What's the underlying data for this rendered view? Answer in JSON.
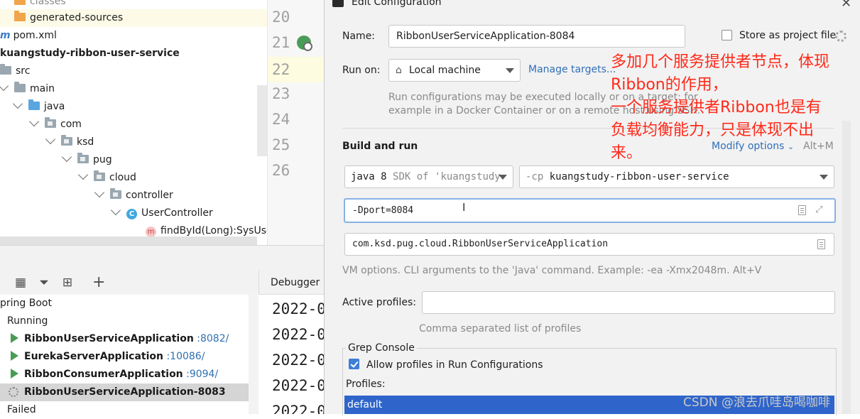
{
  "tree": {
    "items": [
      {
        "label": "classes",
        "icon": "folder-icon",
        "color": "#f0a54b"
      },
      {
        "label": "generated-sources",
        "icon": "folder-icon",
        "color": "#f0a54b"
      },
      {
        "label": "pom.xml",
        "icon": "maven-icon"
      },
      {
        "label": "kuangstudy-ribbon-user-service",
        "icon": "module-icon"
      },
      {
        "label": "src",
        "icon": "folder-icon"
      },
      {
        "label": "main",
        "icon": "folder-icon"
      },
      {
        "label": "java",
        "icon": "source-folder-icon"
      },
      {
        "label": "com",
        "icon": "package-icon"
      },
      {
        "label": "ksd",
        "icon": "package-icon"
      },
      {
        "label": "pug",
        "icon": "package-icon"
      },
      {
        "label": "cloud",
        "icon": "package-icon"
      },
      {
        "label": "controller",
        "icon": "package-icon"
      },
      {
        "label": "UserController",
        "icon": "class-icon"
      },
      {
        "label": "findById(Long):SysUse",
        "icon": "method-icon"
      }
    ],
    "maven_glyph": "m",
    "class_glyph": "C",
    "method_glyph": "m"
  },
  "editor": {
    "line_numbers": [
      "20",
      "21",
      "22",
      "23",
      "24",
      "25",
      "26"
    ]
  },
  "services": {
    "debugger_tab": "Debugger",
    "group": "pring Boot",
    "running_label": "Running",
    "apps": [
      {
        "name": "RibbonUserServiceApplication",
        "port": ":8082/"
      },
      {
        "name": "EurekaServerApplication",
        "port": ":10086/"
      },
      {
        "name": "RibbonConsumerApplication",
        "port": ":9094/"
      }
    ],
    "starting_app": "RibbonUserServiceApplication-8083",
    "failed_label": "Failed",
    "console_lines": [
      "2022-0",
      "2022-0",
      "2022-0",
      "2022-0",
      "2022-0"
    ]
  },
  "dialog": {
    "title": "Edit Configuration",
    "name_label": "Name:",
    "name_value": "RibbonUserServiceApplication-8084",
    "store_label": "Store as project file",
    "run_on_label": "Run on:",
    "run_on_value": "Local machine",
    "manage_targets": "Manage targets...",
    "run_on_help_1": "Run configurations may be executed locally or on a target: for",
    "run_on_help_2": "example in a Docker Container or on a remote host using SSH.",
    "build_and_run": "Build and run",
    "modify_options": "Modify options",
    "modify_shortcut": "Alt+M",
    "jdk_bold": "java 8",
    "jdk_hint": "SDK of 'kuangstudy",
    "cp_prefix": "-cp",
    "cp_value": "kuangstudy-ribbon-user-service",
    "vm_options": "-Dport=8084",
    "main_class": "com.ksd.pug.cloud.RibbonUserServiceApplication",
    "vm_help": "VM options. CLI arguments to the 'Java' command. Example: -ea -Xmx2048m. Alt+V",
    "active_profiles_label": "Active profiles:",
    "active_profiles_value": "",
    "profiles_help": "Comma separated list of profiles",
    "grep_console": "Grep Console",
    "allow_profiles": "Allow profiles in Run Configurations",
    "profiles_label": "Profiles:",
    "profiles_selected": "default"
  },
  "annotation": {
    "line1": "多加几个服务提供者节点，体现",
    "line2": "Ribbon的作用，",
    "line3": "一个服务提供者Ribbon也是有",
    "line4": "负载均衡能力，只是体现不出",
    "line5": "来。",
    "color": "#ff2a1a"
  },
  "watermark": "CSDN @浪去爪哇岛喝咖啡"
}
